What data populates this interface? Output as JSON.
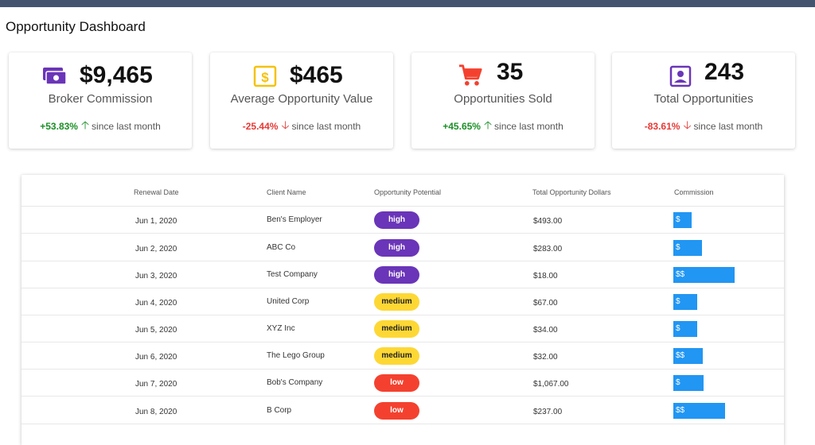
{
  "header": {
    "title": "Opportunity Dashboard"
  },
  "colors": {
    "topbar": "#44546f",
    "up": "#1a8f25",
    "down": "#e53935",
    "high": "#6a35b8",
    "medium": "#fdd835",
    "low": "#f4412f",
    "bar": "#2196f3"
  },
  "cards": [
    {
      "icon": "money-icon",
      "value": "$9,465",
      "label": "Broker Commission",
      "pct": "+53.83%",
      "direction": "up",
      "since": "since last month"
    },
    {
      "icon": "dollar-icon",
      "value": "$465",
      "label": "Average Opportunity Value",
      "pct": "-25.44%",
      "direction": "down",
      "since": "since last month"
    },
    {
      "icon": "cart-icon",
      "value": "35",
      "label": "Opportunities Sold",
      "pct": "+45.65%",
      "direction": "up",
      "since": "since last month"
    },
    {
      "icon": "portrait-icon",
      "value": "243",
      "label": "Total Opportunities",
      "pct": "-83.61%",
      "direction": "down",
      "since": "since last month"
    }
  ],
  "table": {
    "columns": [
      "Renewal Date",
      "Client Name",
      "Opportunity Potential",
      "Total Opportunity Dollars",
      "Commission"
    ],
    "rows": [
      {
        "date": "Jun 1, 2020",
        "client": "Ben's Employer",
        "potential": "high",
        "dollars": "$493.00",
        "commission": "$",
        "commission_fraction": 0.23
      },
      {
        "date": "Jun 2, 2020",
        "client": "ABC Co",
        "potential": "high",
        "dollars": "$283.00",
        "commission": "$",
        "commission_fraction": 0.35
      },
      {
        "date": "Jun 3, 2020",
        "client": "Test Company",
        "potential": "high",
        "dollars": "$18.00",
        "commission": "$$",
        "commission_fraction": 0.75
      },
      {
        "date": "Jun 4, 2020",
        "client": "United Corp",
        "potential": "medium",
        "dollars": "$67.00",
        "commission": "$",
        "commission_fraction": 0.29
      },
      {
        "date": "Jun 5, 2020",
        "client": "XYZ Inc",
        "potential": "medium",
        "dollars": "$34.00",
        "commission": "$",
        "commission_fraction": 0.29
      },
      {
        "date": "Jun 6, 2020",
        "client": "The Lego Group",
        "potential": "medium",
        "dollars": "$32.00",
        "commission": "$$",
        "commission_fraction": 0.36
      },
      {
        "date": "Jun 7, 2020",
        "client": "Bob's Company",
        "potential": "low",
        "dollars": "$1,067.00",
        "commission": "$",
        "commission_fraction": 0.37
      },
      {
        "date": "Jun 8, 2020",
        "client": "B Corp",
        "potential": "low",
        "dollars": "$237.00",
        "commission": "$$",
        "commission_fraction": 0.64
      }
    ]
  }
}
